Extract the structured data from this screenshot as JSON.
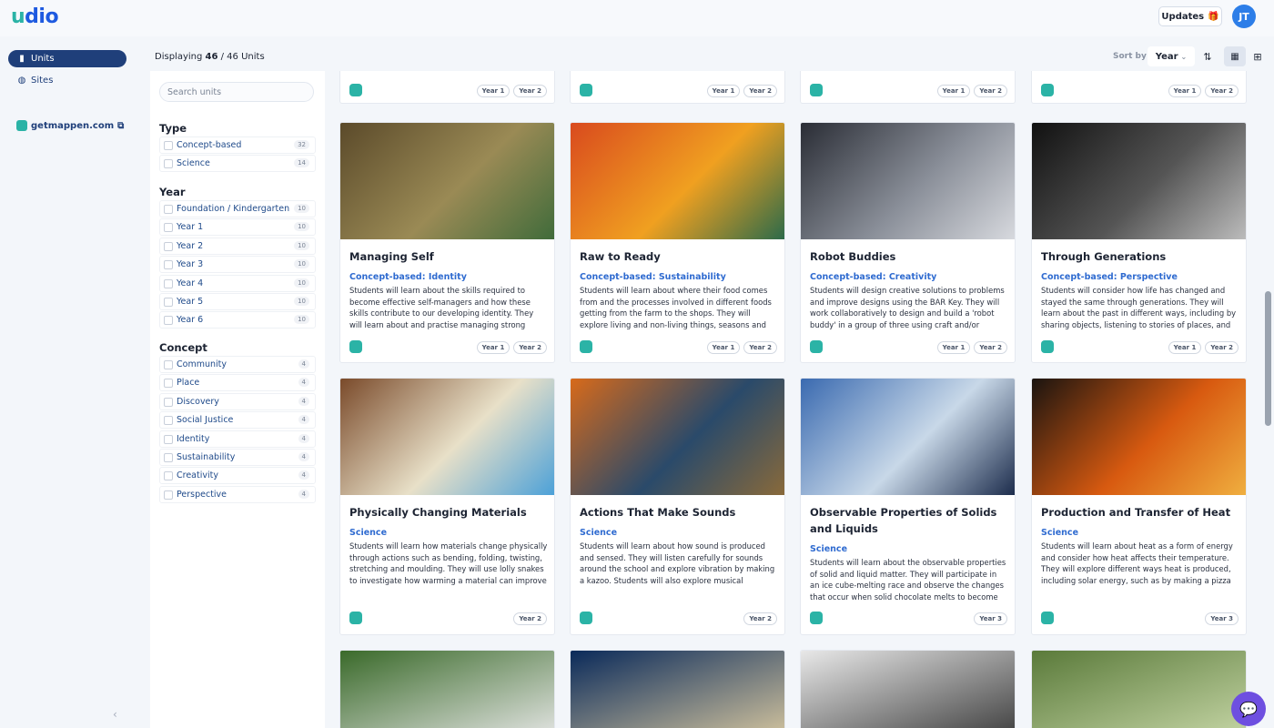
{
  "app": {
    "logo_text": "udio",
    "logo_prefix": "u"
  },
  "topbar": {
    "updates_label": "Updates",
    "avatar_initials": "JT"
  },
  "nav": {
    "items": [
      {
        "label": "Units",
        "icon": "book-icon",
        "active": true
      },
      {
        "label": "Sites",
        "icon": "globe-icon",
        "active": false
      }
    ],
    "external_link": "getmappen.com"
  },
  "header": {
    "displaying_prefix": "Displaying",
    "shown": "46",
    "total": "46",
    "suffix": "Units",
    "sort_label": "Sort by",
    "sort_value": "Year"
  },
  "filters": {
    "search_placeholder": "Search units",
    "groups": [
      {
        "title": "Type",
        "options": [
          {
            "label": "Concept-based",
            "count": "32"
          },
          {
            "label": "Science",
            "count": "14"
          }
        ]
      },
      {
        "title": "Year",
        "options": [
          {
            "label": "Foundation / Kindergarten",
            "count": "10"
          },
          {
            "label": "Year 1",
            "count": "10"
          },
          {
            "label": "Year 2",
            "count": "10"
          },
          {
            "label": "Year 3",
            "count": "10"
          },
          {
            "label": "Year 4",
            "count": "10"
          },
          {
            "label": "Year 5",
            "count": "10"
          },
          {
            "label": "Year 6",
            "count": "10"
          }
        ]
      },
      {
        "title": "Concept",
        "options": [
          {
            "label": "Community",
            "count": "4"
          },
          {
            "label": "Place",
            "count": "4"
          },
          {
            "label": "Discovery",
            "count": "4"
          },
          {
            "label": "Social Justice",
            "count": "4"
          },
          {
            "label": "Identity",
            "count": "4"
          },
          {
            "label": "Sustainability",
            "count": "4"
          },
          {
            "label": "Creativity",
            "count": "4"
          },
          {
            "label": "Perspective",
            "count": "4"
          }
        ]
      }
    ]
  },
  "partial_row_years": [
    [
      "Year 1",
      "Year 2"
    ],
    [
      "Year 1",
      "Year 2"
    ],
    [
      "Year 1",
      "Year 2"
    ],
    [
      "Year 1",
      "Year 2"
    ]
  ],
  "cards": [
    {
      "title": "Managing Self",
      "tag": "Concept-based: Identity",
      "desc": "Students will learn about the skills required to become effective self-managers and how these skills contribute to our developing identity. They will learn about and practise managing strong emotions, givin...",
      "years": [
        "Year 1",
        "Year 2"
      ],
      "img_colors": [
        "#5b4a2a",
        "#9a8a55",
        "#3f6b3a"
      ]
    },
    {
      "title": "Raw to Ready",
      "tag": "Concept-based: Sustainability",
      "desc": "Students will learn about where their food comes from and the processes involved in different foods getting from the farm to the shops. They will explore living and non-living things, seasons and seasonal produce...",
      "years": [
        "Year 1",
        "Year 2"
      ],
      "img_colors": [
        "#d94a1e",
        "#f0a020",
        "#2a6a4a"
      ]
    },
    {
      "title": "Robot Buddies",
      "tag": "Concept-based: Creativity",
      "desc": "Students will design creative solutions to problems and improve designs using the BAR Key. They will work collaboratively to design and build a 'robot buddy' in a group of three using craft and/or recyclable...",
      "years": [
        "Year 1",
        "Year 2"
      ],
      "img_colors": [
        "#2a2d35",
        "#8a8f99",
        "#d8dadf"
      ]
    },
    {
      "title": "Through Generations",
      "tag": "Concept-based: Perspective",
      "desc": "Students will consider how life has changed and stayed the same through generations. They will learn about the past in different ways, including by sharing objects, listening to stories of places, and asking...",
      "years": [
        "Year 1",
        "Year 2"
      ],
      "img_colors": [
        "#111111",
        "#555555",
        "#bdbdbd"
      ]
    },
    {
      "title": "Physically Changing Materials",
      "tag": "Science",
      "desc": "Students will learn how materials change physically through actions such as bending, folding, twisting, stretching and moulding. They will use lolly snakes to investigate how warming a material can improve its...",
      "years": [
        "Year 2"
      ],
      "img_colors": [
        "#7a4a2a",
        "#e8e0c8",
        "#4aa0d8"
      ]
    },
    {
      "title": "Actions That Make Sounds",
      "tag": "Science",
      "desc": "Students will learn about how sound is produced and sensed. They will listen carefully for sounds around the school and explore vibration by making a kazoo. Students will also explore musical instruments and...",
      "years": [
        "Year 2"
      ],
      "img_colors": [
        "#d86a1a",
        "#2a4a6a",
        "#8a6a3a"
      ]
    },
    {
      "title": "Observable Properties of Solids and Liquids",
      "tag": "Science",
      "desc": "Students will learn about the observable properties of solid and liquid matter. They will participate in an ice cube-melting race and observe the changes that occur when solid chocolate melts to become liquid...",
      "years": [
        "Year 3"
      ],
      "img_colors": [
        "#3a6ab0",
        "#c8d8e8",
        "#1a2a4a"
      ]
    },
    {
      "title": "Production and Transfer of Heat",
      "tag": "Science",
      "desc": "Students will learn about heat as a form of energy and consider how heat affects their temperature. They will explore different ways heat is produced, including solar energy, such as by making a pizza box solar...",
      "years": [
        "Year 3"
      ],
      "img_colors": [
        "#1a1410",
        "#d85a10",
        "#f0b040"
      ]
    }
  ],
  "bottom_row_colors": [
    [
      "#3a6a2a",
      "#e8e8e8"
    ],
    [
      "#0a2a5a",
      "#d8c8a0"
    ],
    [
      "#e8e8e8",
      "#3a3a3a"
    ],
    [
      "#5a7a3a",
      "#c8d8a8"
    ]
  ]
}
